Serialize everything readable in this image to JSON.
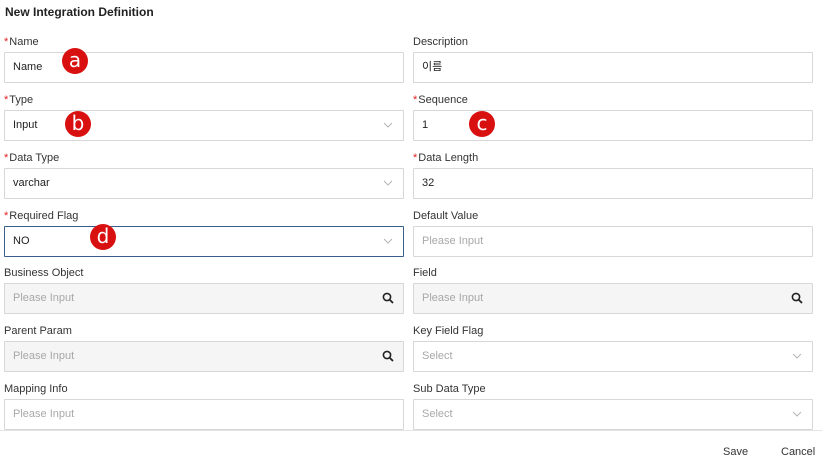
{
  "title": "New Integration Definition",
  "fields": {
    "name": {
      "label": "Name",
      "required": "*",
      "value": "Name"
    },
    "description": {
      "label": "Description",
      "value": "이름"
    },
    "type": {
      "label": "Type",
      "required": "*",
      "value": "Input"
    },
    "sequence": {
      "label": "Sequence",
      "required": "*",
      "value": "1"
    },
    "data_type": {
      "label": "Data Type",
      "required": "*",
      "value": "varchar"
    },
    "data_length": {
      "label": "Data Length",
      "required": "*",
      "value": "32"
    },
    "required_flag": {
      "label": "Required Flag",
      "required": "*",
      "value": "NO"
    },
    "default_value": {
      "label": "Default Value",
      "placeholder": "Please Input"
    },
    "business_object": {
      "label": "Business Object",
      "placeholder": "Please Input"
    },
    "field": {
      "label": "Field",
      "placeholder": "Please Input"
    },
    "parent_param": {
      "label": "Parent Param",
      "placeholder": "Please Input"
    },
    "key_field_flag": {
      "label": "Key Field Flag",
      "placeholder": "Select"
    },
    "mapping_info": {
      "label": "Mapping Info",
      "placeholder": "Please Input"
    },
    "sub_data_type": {
      "label": "Sub Data Type",
      "placeholder": "Select"
    }
  },
  "markers": {
    "a": "a",
    "b": "b",
    "c": "c",
    "d": "d"
  },
  "footer": {
    "save_label": "Save",
    "cancel_label": "Cancel"
  },
  "colors": {
    "marker": "#d91010",
    "required": "#e02020",
    "focus_border": "#3a5d8c"
  }
}
